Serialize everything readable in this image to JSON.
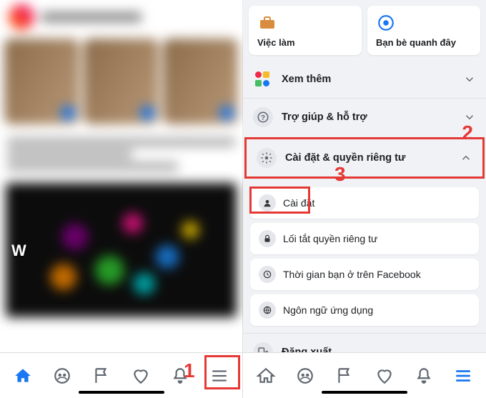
{
  "annotations": {
    "step1": "1",
    "step2": "2",
    "step3": "3"
  },
  "left": {
    "w_logo": "W"
  },
  "right": {
    "cards": {
      "jobs": "Việc làm",
      "friends_nearby": "Bạn bè quanh đây"
    },
    "see_more": "Xem thêm",
    "help": "Trợ giúp & hỗ trợ",
    "settings_privacy": "Cài đặt & quyền riêng tư",
    "sub": {
      "settings": "Cài đặt",
      "privacy_shortcuts": "Lối tắt quyền riêng tư",
      "time_on_fb": "Thời gian bạn ở trên Facebook",
      "app_language": "Ngôn ngữ ứng dụng"
    },
    "logout": "Đăng xuất"
  }
}
